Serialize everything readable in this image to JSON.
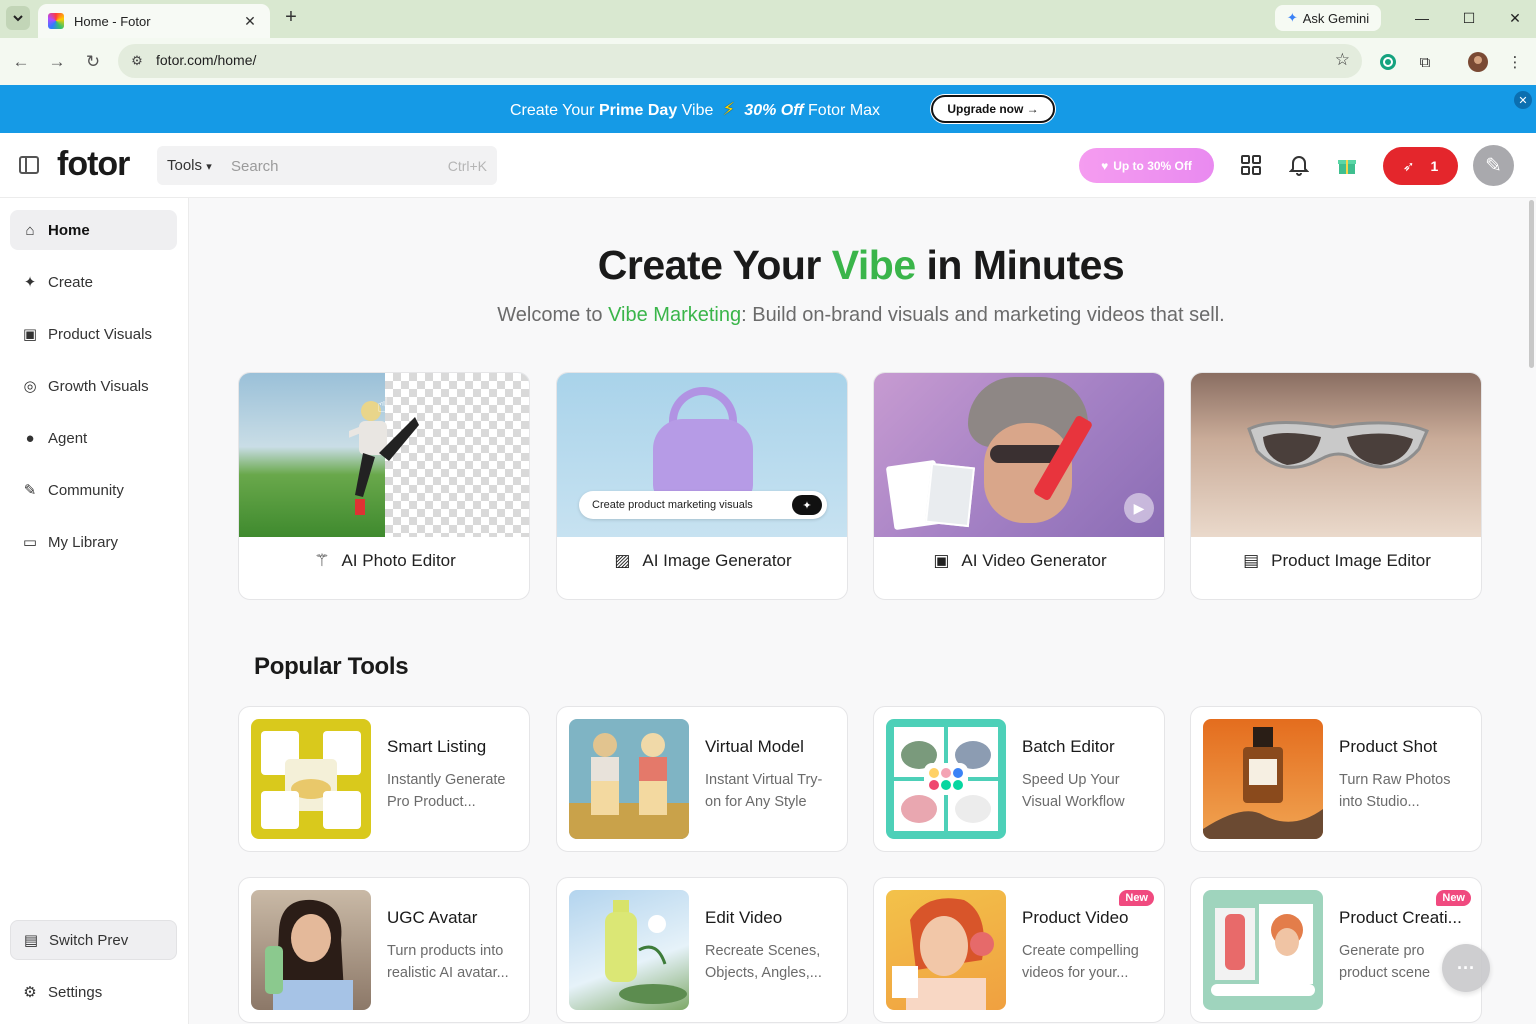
{
  "browser": {
    "tab_title": "Home - Fotor",
    "new_tab_label": "+",
    "gemini_label": "Ask Gemini",
    "url": "fotor.com/home/"
  },
  "promo": {
    "text_prefix": "Create Your ",
    "text_bold": "Prime Day",
    "text_mid": " Vibe ",
    "text_offer": "30% Off",
    "text_suffix": " Fotor Max",
    "upgrade_label": "Upgrade now →",
    "accent_color": "#159ae6"
  },
  "header": {
    "logo": "fotor",
    "tools_label": "Tools",
    "search_placeholder": "Search",
    "search_shortcut": "Ctrl+K",
    "discount_label": "Up to 30% Off",
    "credits_count": "1"
  },
  "sidebar": {
    "items": [
      {
        "label": "Home",
        "icon": "home-icon",
        "active": true
      },
      {
        "label": "Create",
        "icon": "sparkle-icon"
      },
      {
        "label": "Product Visuals",
        "icon": "bag-icon"
      },
      {
        "label": "Growth Visuals",
        "icon": "growth-icon"
      },
      {
        "label": "Agent",
        "icon": "agent-icon"
      },
      {
        "label": "Community",
        "icon": "brush-icon"
      },
      {
        "label": "My Library",
        "icon": "folder-icon"
      }
    ],
    "switch_label": "Switch Prev",
    "settings_label": "Settings"
  },
  "hero": {
    "title_before": "Create Your ",
    "title_accent": "Vibe",
    "title_after": " in Minutes",
    "sub_before": "Welcome to ",
    "sub_accent": "Vibe Marketing",
    "sub_after": ": Build on-brand visuals and marketing videos that sell.",
    "accent_color": "#3ab54a"
  },
  "features": [
    {
      "label": "AI Photo Editor",
      "icon": "magic-wand-icon"
    },
    {
      "label": "AI Image Generator",
      "icon": "image-plus-icon",
      "prompt": "Create product marketing visuals"
    },
    {
      "label": "AI Video Generator",
      "icon": "video-plus-icon"
    },
    {
      "label": "Product Image Editor",
      "icon": "bag-edit-icon"
    }
  ],
  "popular": {
    "title": "Popular Tools",
    "tools": [
      {
        "name": "Smart Listing",
        "desc1": "Instantly Generate",
        "desc2": "Pro Product..."
      },
      {
        "name": "Virtual Model",
        "desc1": "Instant Virtual Try-",
        "desc2": "on for Any Style"
      },
      {
        "name": "Batch Editor",
        "desc1": "Speed Up Your",
        "desc2": "Visual Workflow"
      },
      {
        "name": "Product Shot",
        "desc1": "Turn Raw Photos",
        "desc2": "into Studio..."
      },
      {
        "name": "UGC Avatar",
        "desc1": "Turn products into",
        "desc2": "realistic AI avatar..."
      },
      {
        "name": "Edit Video",
        "desc1": "Recreate Scenes,",
        "desc2": "Objects, Angles,..."
      },
      {
        "name": "Product Video",
        "desc1": "Create compelling",
        "desc2": "videos for your...",
        "badge": "New"
      },
      {
        "name": "Product Creati...",
        "desc1": "Generate pro",
        "desc2": "product scene",
        "badge": "New"
      }
    ]
  }
}
